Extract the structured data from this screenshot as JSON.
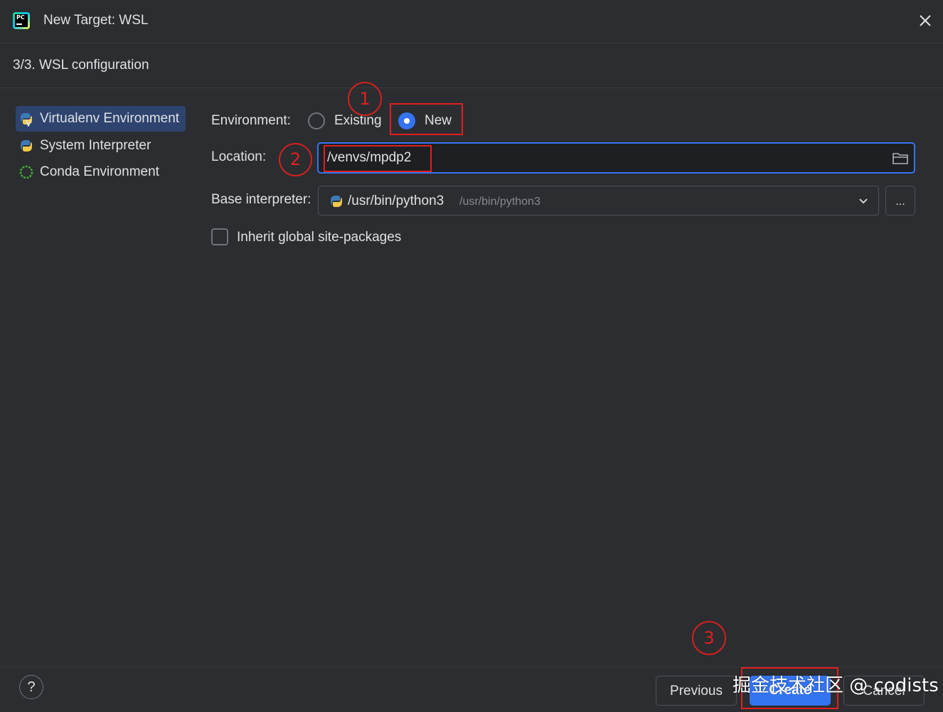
{
  "window": {
    "title": "New Target: WSL",
    "app_icon_label": "PC",
    "close_icon": "close-icon"
  },
  "step": {
    "title": "3/3. WSL configuration"
  },
  "sidebar": {
    "items": [
      {
        "label": "Virtualenv Environment",
        "icon": "virtualenv-icon",
        "selected": true
      },
      {
        "label": "System Interpreter",
        "icon": "python-icon",
        "selected": false
      },
      {
        "label": "Conda Environment",
        "icon": "conda-icon",
        "selected": false
      }
    ]
  },
  "form": {
    "environment": {
      "label": "Environment:",
      "options": [
        {
          "label": "Existing",
          "selected": false
        },
        {
          "label": "New",
          "selected": true
        }
      ]
    },
    "location": {
      "label": "Location:",
      "value": "/venvs/mpdp2"
    },
    "base_interpreter": {
      "label": "Base interpreter:",
      "value": "/usr/bin/python3",
      "hint": "/usr/bin/python3",
      "browse_label": "..."
    },
    "inherit": {
      "label": "Inherit global site-packages",
      "checked": false
    }
  },
  "annotations": {
    "markers": [
      "1",
      "2",
      "3"
    ]
  },
  "footer": {
    "help_label": "?",
    "previous_label": "Previous",
    "create_label": "Create",
    "cancel_label": "Cancel"
  },
  "watermark": {
    "text": "掘金技术社区 @ codists"
  },
  "colors": {
    "background": "#2b2d30",
    "accent": "#3574f0",
    "selected_item": "#2e436e",
    "annotation": "#e02020",
    "text": "#dfe1e5",
    "muted_text": "#868a91"
  }
}
